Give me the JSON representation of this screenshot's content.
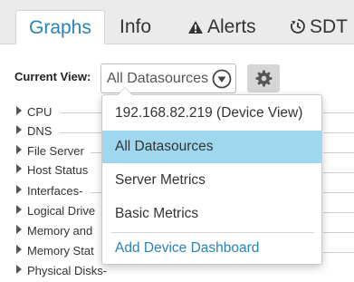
{
  "tabs": [
    {
      "label": "Graphs",
      "active": true
    },
    {
      "label": "Info"
    },
    {
      "label": "Alerts",
      "icon": "warning-icon"
    },
    {
      "label": "SDT",
      "icon": "sdt-clock-icon"
    }
  ],
  "view": {
    "label": "Current View:",
    "selected": "All Datasources",
    "settings_icon": "gear-icon"
  },
  "tree": [
    {
      "label": "CPU"
    },
    {
      "label": "DNS"
    },
    {
      "label": "File Server"
    },
    {
      "label": "Host Status"
    },
    {
      "label": "Interfaces-"
    },
    {
      "label": "Logical Drive"
    },
    {
      "label": "Memory and"
    },
    {
      "label": "Memory Stat"
    },
    {
      "label": "Physical Disks-"
    }
  ],
  "dropdown": {
    "items": [
      {
        "label": "192.168.82.219 (Device View)"
      },
      {
        "label": "All Datasources",
        "selected": true
      },
      {
        "label": "Server Metrics"
      },
      {
        "label": "Basic Metrics"
      }
    ],
    "add_label": "Add Device Dashboard"
  },
  "colors": {
    "accent": "#2a83b5",
    "selected_bg": "#9fd8ee",
    "tabbar_bg": "#ebebeb"
  }
}
